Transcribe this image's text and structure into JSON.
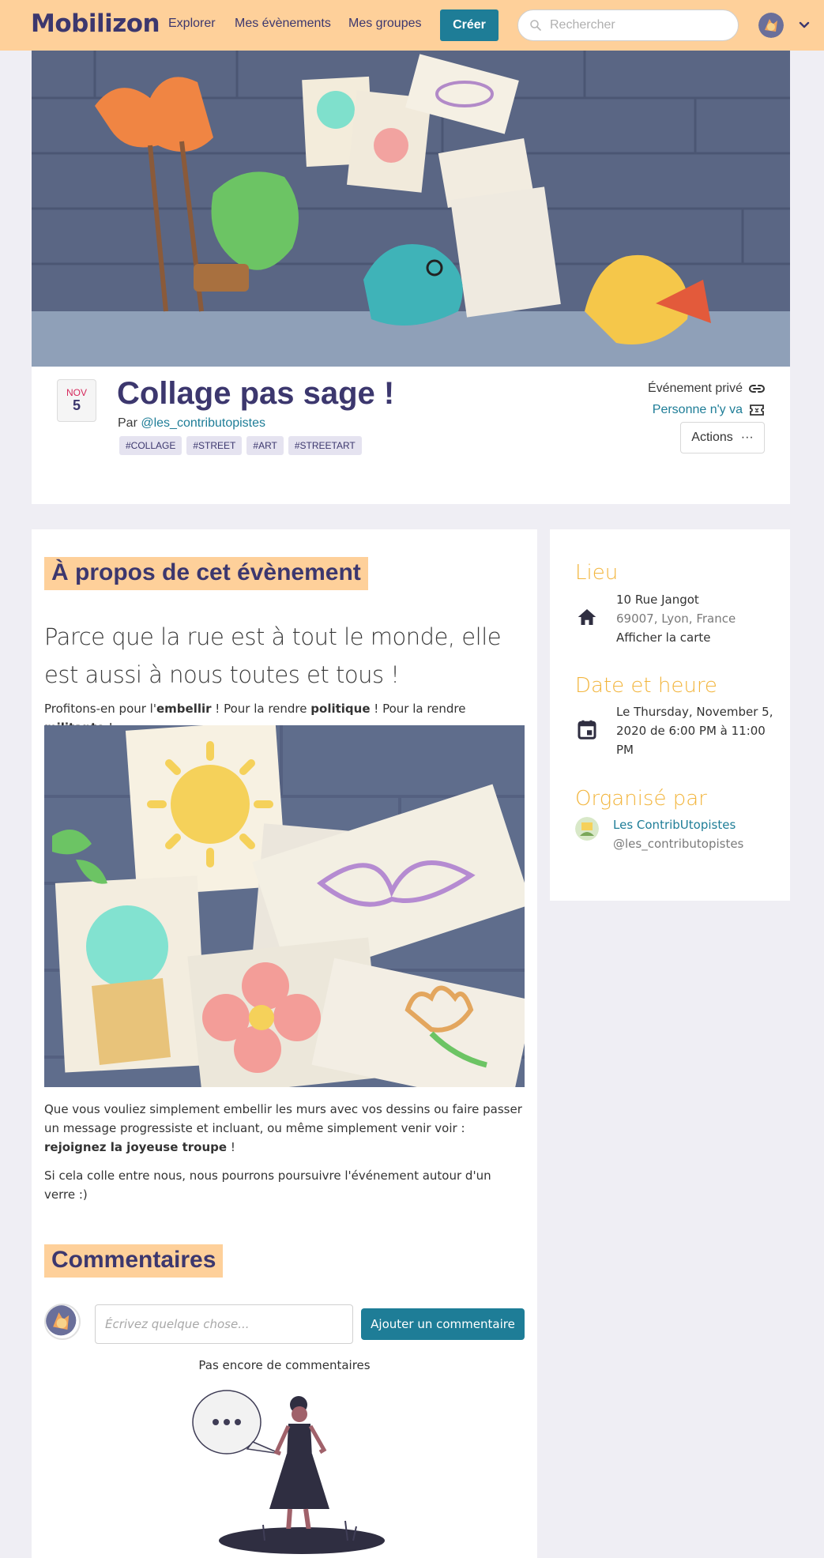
{
  "nav": {
    "logo": "Mobilizon",
    "explore": "Explorer",
    "my_events": "Mes évènements",
    "my_groups": "Mes groupes",
    "create": "Créer",
    "search_placeholder": "Rechercher"
  },
  "event": {
    "month": "NOV",
    "day": "5",
    "title": "Collage pas sage !",
    "by_prefix": "Par",
    "organizer_handle": "@les_contributopistes",
    "tags": [
      "#COLLAGE",
      "#STREET",
      "#ART",
      "#STREETART"
    ],
    "visibility": "Événement privé",
    "participation": "Personne n'y va",
    "actions": "Actions"
  },
  "about": {
    "heading": "À propos de cet évènement",
    "lead": "Parce que la rue est à tout le monde, elle est aussi à nous toutes et tous !",
    "p1_a": "Profitons-en pour l'",
    "p1_b": "embellir",
    "p1_c": " ! Pour la rendre ",
    "p1_d": "politique",
    "p1_e": " ! Pour la rendre ",
    "p1_f": "militante",
    "p1_g": " !",
    "p2_a": "Que vous vouliez simplement embellir les murs avec vos dessins ou faire passer un message progressiste et incluant, ou même simplement venir voir : ",
    "p2_b": "rejoignez la joyeuse troupe",
    "p2_c": " !",
    "p3": "Si cela colle entre nous, nous pourrons poursuivre l'événement autour d'un verre :)"
  },
  "comments": {
    "heading": "Commentaires",
    "placeholder": "Écrivez quelque chose...",
    "submit": "Ajouter un commentaire",
    "empty": "Pas encore de commentaires"
  },
  "sidebar": {
    "place_title": "Lieu",
    "address_line1": "10 Rue Jangot",
    "address_line2": "69007, Lyon, France",
    "show_map": "Afficher la carte",
    "date_title": "Date et heure",
    "date_text": "Le Thursday, November 5, 2020 de 6:00 PM à 11:00 PM",
    "org_title": "Organisé par",
    "org_name": "Les ContribUtopistes",
    "org_handle": "@les_contributopistes"
  },
  "colors": {
    "brand_primary": "#3c376e",
    "brand_secondary": "#fed09a",
    "accent": "#1e7d97",
    "sidebar_title": "#f2b53d",
    "background": "#efeef4"
  }
}
